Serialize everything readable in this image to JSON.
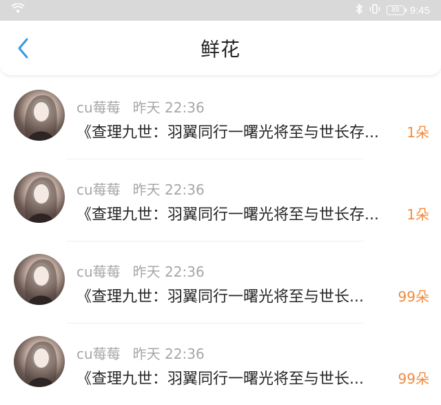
{
  "status_bar": {
    "time": "9:45",
    "battery": "89",
    "icons": [
      "wifi-icon",
      "bluetooth-icon",
      "vibrate-icon",
      "battery-icon"
    ]
  },
  "header": {
    "title": "鲜花",
    "back_icon": "chevron-left-icon"
  },
  "colors": {
    "accent": "#2f9ae5",
    "amount": "#f08a3e",
    "status_bar_bg": "#d9d9d9"
  },
  "items": [
    {
      "user": "cu莓莓",
      "time": "昨天 22:36",
      "content": "《查理九世：羽翼同行一曙光将至与世长存...",
      "amount": "1朵"
    },
    {
      "user": "cu莓莓",
      "time": "昨天 22:36",
      "content": "《查理九世：羽翼同行一曙光将至与世长存...",
      "amount": "1朵"
    },
    {
      "user": "cu莓莓",
      "time": "昨天 22:36",
      "content": "《查理九世：羽翼同行一曙光将至与世长...",
      "amount": "99朵"
    },
    {
      "user": "cu莓莓",
      "time": "昨天 22:36",
      "content": "《查理九世：羽翼同行一曙光将至与世长...",
      "amount": "99朵"
    }
  ]
}
